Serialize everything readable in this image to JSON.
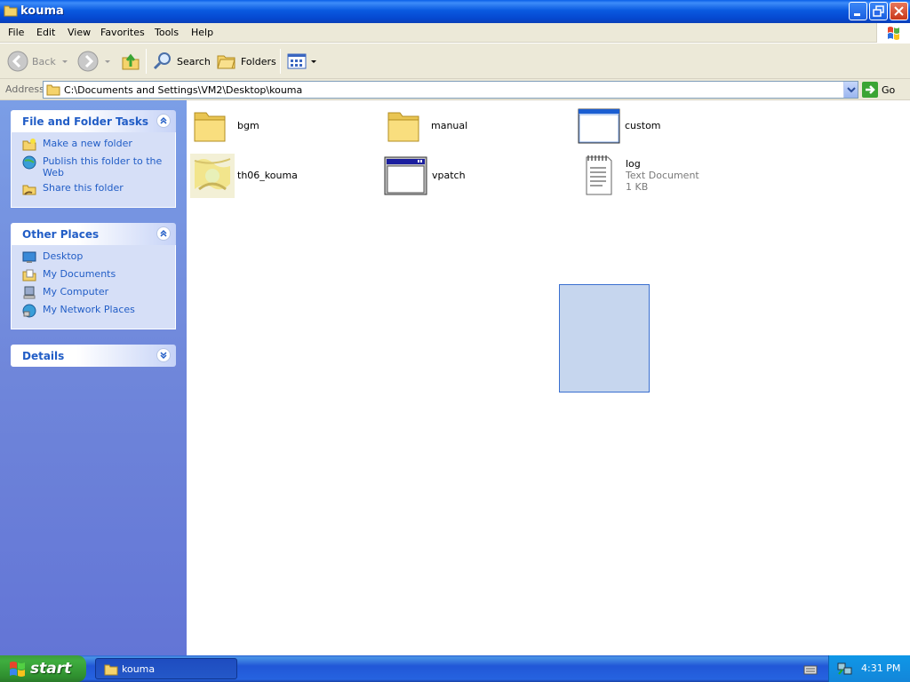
{
  "window": {
    "title": "kouma",
    "controls": [
      "minimize",
      "maximize",
      "close"
    ]
  },
  "menubar": {
    "items": [
      "File",
      "Edit",
      "View",
      "Favorites",
      "Tools",
      "Help"
    ]
  },
  "toolbar": {
    "back_label": "Back",
    "search_label": "Search",
    "folders_label": "Folders"
  },
  "address": {
    "label": "Address",
    "value": "C:\\Documents and Settings\\VM2\\Desktop\\kouma",
    "go_label": "Go"
  },
  "sidebar": {
    "tasks": {
      "title": "File and Folder Tasks",
      "items": [
        "Make a new folder",
        "Publish this folder to the Web",
        "Share this folder"
      ]
    },
    "places": {
      "title": "Other Places",
      "items": [
        "Desktop",
        "My Documents",
        "My Computer",
        "My Network Places"
      ]
    },
    "details": {
      "title": "Details"
    }
  },
  "files": [
    {
      "name": "bgm",
      "kind": "folder"
    },
    {
      "name": "manual",
      "kind": "folder"
    },
    {
      "name": "custom",
      "kind": "window"
    },
    {
      "name": "th06_kouma",
      "kind": "image"
    },
    {
      "name": "vpatch",
      "kind": "window"
    },
    {
      "name": "log",
      "kind": "text",
      "type": "Text Document",
      "size": "1 KB"
    }
  ],
  "taskbar": {
    "start_label": "start",
    "window_label": "kouma",
    "clock": "4:31 PM"
  },
  "colors": {
    "title_blue": "#0a5ae0",
    "task_pane_blue": "#6f86da",
    "link_blue": "#215dc6",
    "start_green": "#3fae3f",
    "selection": "#c6d6ee"
  }
}
